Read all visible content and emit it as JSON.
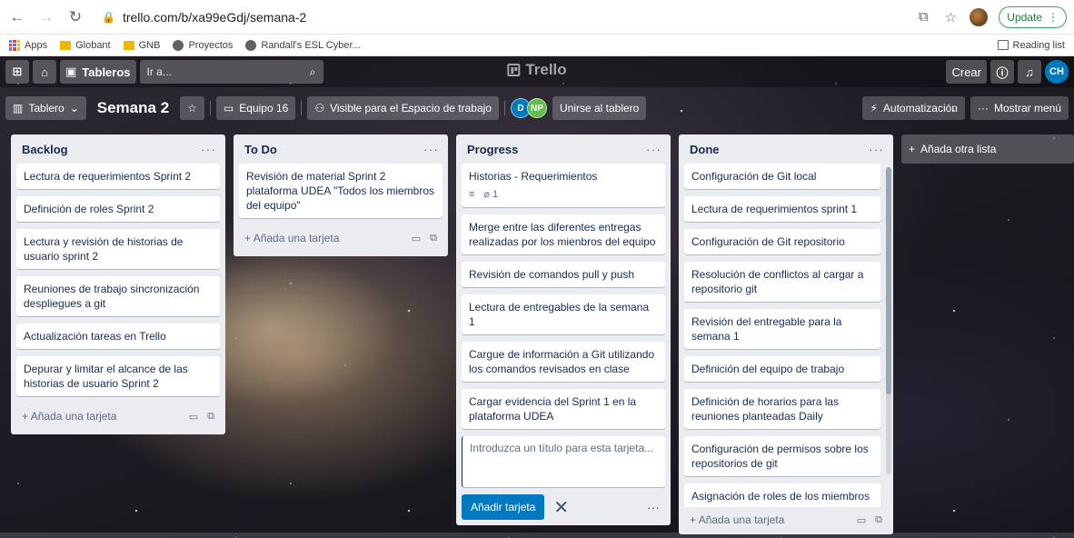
{
  "browser": {
    "url": "trello.com/b/xa99eGdj/semana-2",
    "update_label": "Update",
    "bookmarks": [
      "Apps",
      "Globant",
      "GNB",
      "Proyectos",
      "Randall's ESL Cyber..."
    ],
    "reading_list": "Reading list"
  },
  "topbar": {
    "boards_label": "Tableros",
    "search_placeholder": "Ir a...",
    "logo": "Trello",
    "create_label": "Crear",
    "avatar": "CH"
  },
  "boardbar": {
    "view_label": "Tablero",
    "title": "Semana 2",
    "team": "Equipo 16",
    "visibility": "Visible para el Espacio de trabajo",
    "members": [
      "D",
      "NP"
    ],
    "join_label": "Unirse al tablero",
    "automation_label": "Automatización",
    "menu_label": "Mostrar menú"
  },
  "lists": [
    {
      "title": "Backlog",
      "cards": [
        "Lectura de requerimientos Sprint 2",
        "Definición de roles Sprint 2",
        "Lectura y revisión de historias de usuario sprint 2",
        "Reuniones de trabajo sincronización despliegues a git",
        "Actualización tareas en Trello",
        "Depurar y limitar el alcance de las historias de usuario Sprint 2"
      ],
      "add_label": "Añada una tarjeta"
    },
    {
      "title": "To Do",
      "cards": [
        "Revisión de material Sprint 2 plataforma UDEA \"Todos los miembros del equipo\""
      ],
      "add_label": "Añada una tarjeta"
    },
    {
      "title": "Progress",
      "cards": [
        "Historias - Requerimientos",
        "Merge entre las diferentes entregas realizadas por los mienbros del equipo",
        "Revisión de comandos pull y push",
        "Lectura de entregables de la semana 1",
        "Cargue de información a Git utilizando los comandos revisados en clase",
        "Cargar evidencia del Sprint 1 en la plataforma UDEA"
      ],
      "first_card_attachments": "1",
      "composer_placeholder": "Introduzca un título para esta tarjeta...",
      "composer_add_label": "Añadir tarjeta"
    },
    {
      "title": "Done",
      "cards": [
        "Configuración de Git local",
        "Lectura de requerimientos sprint 1",
        "Configuración de Git repositorio",
        "Resolución de conflictos al cargar a repositorio git",
        "Revisión del entregable para la semana 1",
        "Definición del equipo de trabajo",
        "Definición de horarios para las reuniones planteadas Daily",
        "Configuración de permisos sobre los repositorios de git",
        "Asignación de roles de los miembros"
      ],
      "add_label": "Añada una tarjeta"
    }
  ],
  "add_list_label": "Añada otra lista"
}
